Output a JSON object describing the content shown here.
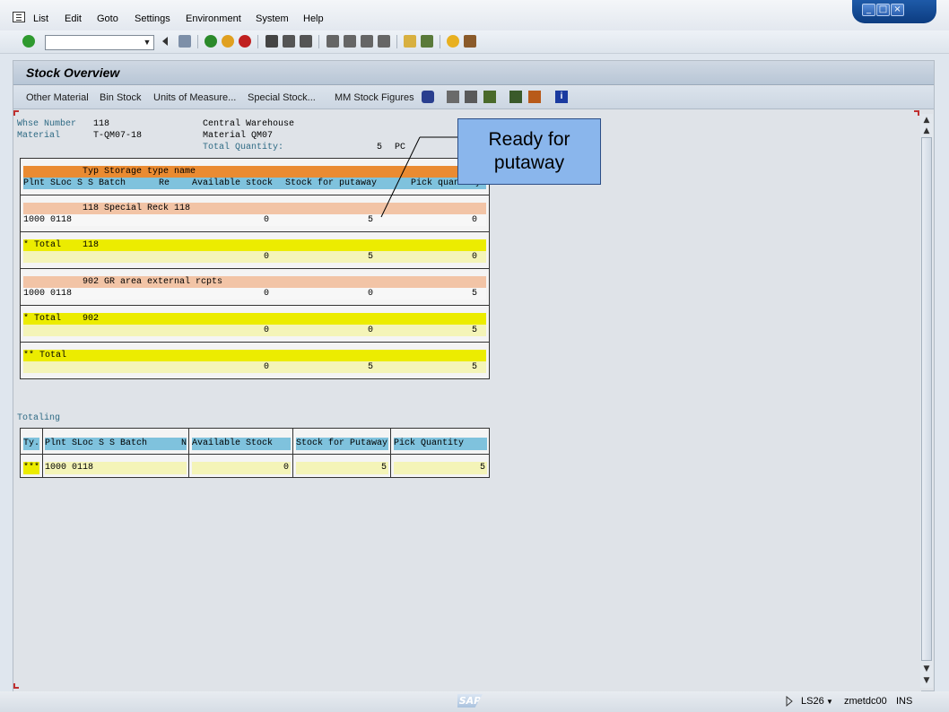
{
  "menu": {
    "items": [
      "List",
      "Edit",
      "Goto",
      "Settings",
      "Environment",
      "System",
      "Help"
    ]
  },
  "window_controls": [
    "minimize-icon",
    "maximize-icon",
    "close-icon"
  ],
  "std_toolbar": {
    "command_field_value": "",
    "icons": [
      "enter-checkmark-icon",
      "back-icon",
      "save-icon",
      "back-green-icon",
      "exit-icon",
      "cancel-icon",
      "print-icon",
      "find-icon",
      "find-next-icon",
      "first-page-icon",
      "previous-page-icon",
      "next-page-icon",
      "last-page-icon",
      "create-session-icon",
      "shortcut-icon",
      "help-icon",
      "layout-icon"
    ]
  },
  "screen": {
    "title": "Stock Overview"
  },
  "app_toolbar": {
    "buttons": [
      "Other Material",
      "Bin Stock",
      "Units of Measure...",
      "Special Stock...",
      "MM Stock Figures"
    ],
    "icons": [
      "refresh-icon",
      "copy-icon",
      "print-list-icon",
      "filter-icon",
      "sum-icon",
      "subtotal-icon",
      "info-icon"
    ]
  },
  "header": {
    "whse_label": "Whse Number",
    "whse_value": "118",
    "whse_desc": "Central Warehouse",
    "material_label": "Material",
    "material_value": "T-QM07-18",
    "material_desc": "Material QM07",
    "total_qty_label": "Total Quantity:",
    "total_qty_value": "5",
    "total_qty_unit": "PC"
  },
  "list": {
    "header_row1": "Typ Storage type name",
    "header_row2_cols": [
      "Plnt SLoc S S Batch",
      "Re",
      "Available stock",
      "Stock for putaway",
      "Pick quantity"
    ],
    "groups": [
      {
        "type_row": "118 Special Reck 118",
        "detail": {
          "plnt_sloc": "1000 0118",
          "available": "0",
          "putaway": "5",
          "pick": "0"
        },
        "total_label": "* Total",
        "total_type": "118",
        "total": {
          "available": "0",
          "putaway": "5",
          "pick": "0"
        }
      },
      {
        "type_row": "902 GR area external rcpts",
        "detail": {
          "plnt_sloc": "1000 0118",
          "available": "0",
          "putaway": "0",
          "pick": "5"
        },
        "total_label": "* Total",
        "total_type": "902",
        "total": {
          "available": "0",
          "putaway": "0",
          "pick": "5"
        }
      }
    ],
    "grand_total_label": "** Total",
    "grand_total": {
      "available": "0",
      "putaway": "5",
      "pick": "5"
    }
  },
  "totaling": {
    "title": "Totaling",
    "headers": [
      "Ty.",
      "Plnt SLoc S S Batch",
      "N",
      "Available Stock",
      "Stock for Putaway",
      "Pick Quantity"
    ],
    "row": {
      "ty": "***",
      "plnt_sloc": "1000 0118",
      "available": "0",
      "putaway": "5",
      "pick": "5"
    }
  },
  "callout": {
    "text_line1": "Ready for",
    "text_line2": "putaway"
  },
  "status": {
    "transaction": "LS26",
    "server": "zmetdc00",
    "mode": "INS"
  }
}
